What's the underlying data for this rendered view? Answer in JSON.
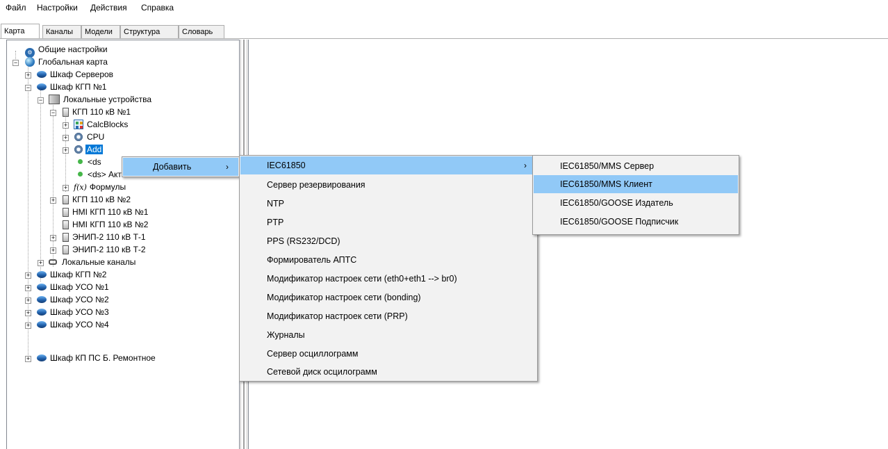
{
  "menubar": [
    "Файл",
    "Настройки",
    "Действия",
    "Справка"
  ],
  "tabs": [
    "Карта",
    "Каналы",
    "Модели",
    "Структура",
    "Словарь"
  ],
  "tree": {
    "general_settings": "Общие настройки",
    "global_map": "Глобальная карта",
    "cab_servers": "Шкаф Серверов",
    "cab_kgp1": "Шкаф КГП №1",
    "local_devices": "Локальные устройства",
    "kgp_110_1": "КГП 110 кВ №1",
    "calcblocks": "CalcBlocks",
    "cpu": "CPU",
    "addons": "Add",
    "ds1": "<ds",
    "ds2": "<ds> Активный/Пассивный",
    "formulas": "Формулы",
    "kgp_110_2": "КГП 110 кВ №2",
    "hmi_1": "HMI КГП 110 кВ №1",
    "hmi_2": "HMI КГП 110 кВ №2",
    "enip_t1": "ЭНИП-2 110 кВ Т-1",
    "enip_t2": "ЭНИП-2 110 кВ Т-2",
    "local_channels": "Локальные каналы",
    "cab_kgp2": "Шкаф КГП №2",
    "cab_uso1": "Шкаф УСО №1",
    "cab_uso2": "Шкаф УСО №2",
    "cab_uso3": "Шкаф УСО №3",
    "cab_uso4": "Шкаф УСО №4",
    "cab_kp": "Шкаф КП ПС Б. Ремонтное"
  },
  "context_menu": {
    "add": "Добавить",
    "submenu": [
      "IEC61850",
      "Сервер резервирования",
      "NTP",
      "PTP",
      "PPS (RS232/DCD)",
      "Формирователь АПТС",
      "Модификатор настроек сети (eth0+eth1 --> br0)",
      "Модификатор настроек сети (bonding)",
      "Модификатор настроек сети (PRP)",
      "Журналы",
      "Сервер осциллограмм",
      "Сетевой диск осцилограмм"
    ],
    "iec_submenu": [
      "IEC61850/MMS Сервер",
      "IEC61850/MMS Клиент",
      "IEC61850/GOOSE Издатель",
      "IEC61850/GOOSE Подписчик"
    ],
    "arrow": "›"
  },
  "colors": {
    "selection": "#0078d7",
    "menu_highlight": "#91c9f7",
    "menu_bg": "#f2f2f2"
  }
}
